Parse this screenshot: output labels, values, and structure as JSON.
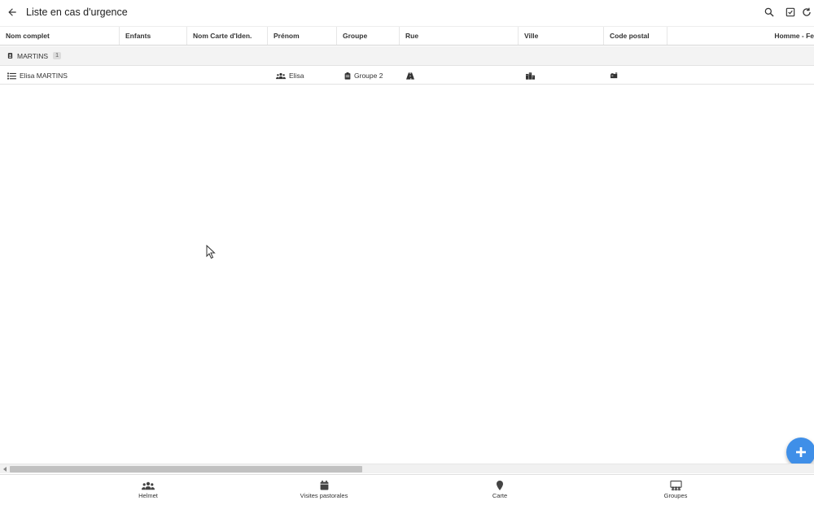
{
  "appbar": {
    "title": "Liste en cas d'urgence",
    "back_icon": "arrow-back-icon",
    "actions": [
      "search-icon",
      "checkbox-icon",
      "refresh-icon"
    ]
  },
  "table": {
    "columns": [
      "Nom complet",
      "Enfants",
      "Nom Carte d'Iden.",
      "Prénom",
      "Groupe",
      "Rue",
      "Ville",
      "Code postal",
      "Homme - Fe"
    ],
    "group": {
      "name": "MARTINS",
      "count": "1"
    },
    "rows": [
      {
        "full_name": "Elisa MARTINS",
        "first_name": "Elisa",
        "group": "Groupe 2"
      }
    ]
  },
  "bottom_nav": {
    "items": [
      {
        "label": "Helmet",
        "icon": "people-icon"
      },
      {
        "label": "Visites pastorales",
        "icon": "calendar-icon"
      },
      {
        "label": "Carte",
        "icon": "map-pin-icon"
      },
      {
        "label": "Groupes",
        "icon": "groups-icon"
      }
    ]
  },
  "colors": {
    "accent": "#3f8fe8",
    "group_row_bg": "#f3f3f3"
  }
}
